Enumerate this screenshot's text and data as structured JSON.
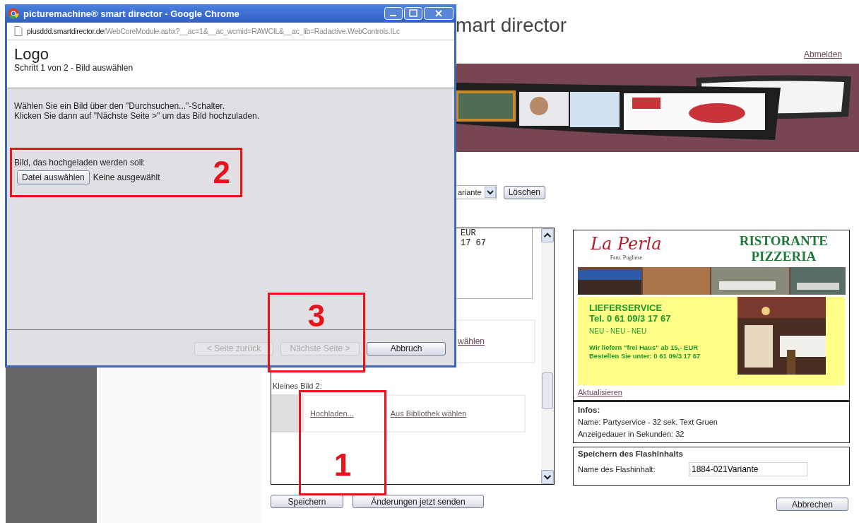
{
  "popup": {
    "title": "picturemachine® smart director - Google Chrome",
    "url_host": "plusddd.smartdirector.de",
    "url_path": "/WebCoreModule.ashx?__ac=1&__ac_wcmid=RAWCIL&__ac_lib=Radactive.WebControls.ILc",
    "heading": "Logo",
    "subheading": "Schritt 1 von 2 - Bild auswählen",
    "instructions": [
      "Wählen Sie ein Bild über den \"Durchsuchen...\"-Schalter.",
      "Klicken Sie dann auf \"Nächste Seite >\" um das Bild hochzuladen."
    ],
    "file_label": "Bild, das hochgeladen werden soll:",
    "file_button": "Datei auswählen",
    "file_status": "Keine ausgewählt",
    "buttons": [
      {
        "label": "< Seite zurück",
        "disabled": true
      },
      {
        "label": "Nächste Seite >",
        "disabled": true
      },
      {
        "label": "Abbruch",
        "disabled": false
      }
    ]
  },
  "page": {
    "title": "mart director",
    "logout": "Abmelden",
    "variant_select": "ariante",
    "delete_button": "Löschen",
    "editor_lines": [
      "EUR",
      "17 67"
    ],
    "library_link": "wählen",
    "small_image_label": "Kleines Bild 2:",
    "small_image_links": [
      "Hochladen...",
      "Aus Bibliothek wählen"
    ],
    "buttons": [
      "Speichern",
      "Änderungen jetzt senden"
    ],
    "preview": {
      "logo": "La Perla",
      "logo_sub": "Fam. Pugliese",
      "headline": [
        "RISTORANTE",
        "PIZZERIA"
      ],
      "service": "LIEFERSERVICE",
      "phone": "Tel. 0 61 09/3 17 67",
      "news": "NEU - NEU - NEU",
      "offer": [
        "Wir liefern \"frei Haus\" ab 15,- EUR",
        "Bestellen Sie unter: 0 61 09/3 17 67"
      ],
      "refresh": "Aktualisieren"
    },
    "infos": {
      "heading": "Infos:",
      "lines": [
        "Name: Partyservice - 32 sek. Text Gruen",
        "Anzeigedauer in Sekunden: 32"
      ]
    },
    "save": {
      "heading": "Speichern des Flashinhalts",
      "label": "Name des Flashinhalt:",
      "value": "1884-021Variante"
    },
    "cancel": "Abbrechen"
  },
  "annotations": [
    {
      "number": "2"
    },
    {
      "number": "3"
    },
    {
      "number": "1"
    }
  ]
}
